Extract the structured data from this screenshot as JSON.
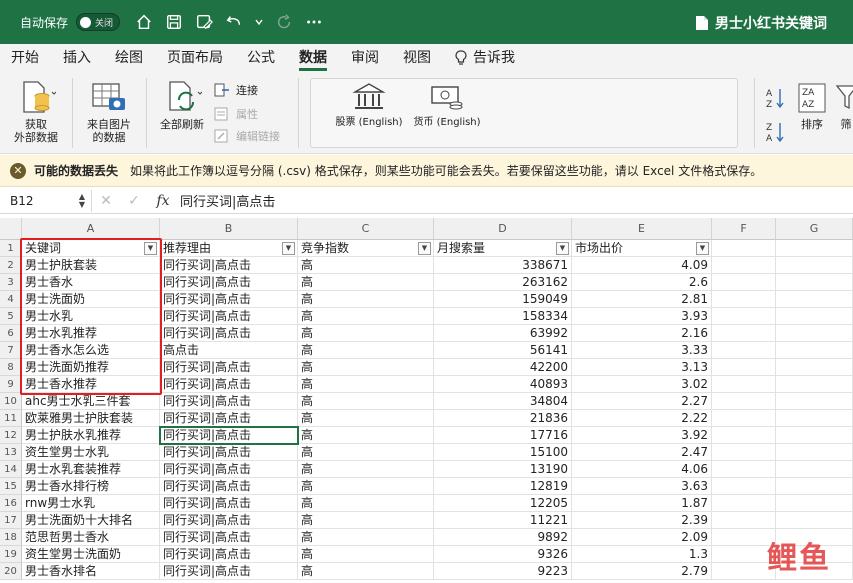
{
  "titlebar": {
    "autosave_label": "自动保存",
    "toggle_label": "关闭",
    "doc_title": "男士小红书关键词"
  },
  "menu": {
    "tabs": [
      {
        "label": "开始"
      },
      {
        "label": "插入"
      },
      {
        "label": "绘图"
      },
      {
        "label": "页面布局"
      },
      {
        "label": "公式"
      },
      {
        "label": "数据"
      },
      {
        "label": "审阅"
      },
      {
        "label": "视图"
      }
    ],
    "tell_me": "告诉我"
  },
  "ribbon": {
    "get_data_line1": "获取",
    "get_data_line2": "外部数据",
    "from_picture_line1": "来自图片",
    "from_picture_line2": "的数据",
    "refresh_all": "全部刷新",
    "connections": "连接",
    "properties": "属性",
    "edit_links": "编辑链接",
    "stocks": "股票 (English)",
    "currencies": "货币 (English)",
    "sort": "排序",
    "filter": "筛"
  },
  "warning": {
    "title": "可能的数据丢失",
    "message": "如果将此工作簿以逗号分隔 (.csv) 格式保存，则某些功能可能会丢失。若要保留这些功能，请以 Excel 文件格式保存。"
  },
  "formula_bar": {
    "name_box": "B12",
    "fx": "fx",
    "formula": "同行买词|高点击"
  },
  "columns": [
    "A",
    "B",
    "C",
    "D",
    "E",
    "F",
    "G"
  ],
  "table": {
    "headers": [
      "关键词",
      "推荐理由",
      "竞争指数",
      "月搜索量",
      "市场出价"
    ],
    "rows": [
      [
        "男士护肤套装",
        "同行买词|高点击",
        "高",
        "338671",
        "4.09"
      ],
      [
        "男士香水",
        "同行买词|高点击",
        "高",
        "263162",
        "2.6"
      ],
      [
        "男士洗面奶",
        "同行买词|高点击",
        "高",
        "159049",
        "2.81"
      ],
      [
        "男士水乳",
        "同行买词|高点击",
        "高",
        "158334",
        "3.93"
      ],
      [
        "男士水乳推荐",
        "同行买词|高点击",
        "高",
        "63992",
        "2.16"
      ],
      [
        "男士香水怎么选",
        "高点击",
        "高",
        "56141",
        "3.33"
      ],
      [
        "男士洗面奶推荐",
        "同行买词|高点击",
        "高",
        "42200",
        "3.13"
      ],
      [
        "男士香水推荐",
        "同行买词|高点击",
        "高",
        "40893",
        "3.02"
      ],
      [
        "ahc男士水乳三件套",
        "同行买词|高点击",
        "高",
        "34804",
        "2.27"
      ],
      [
        "欧莱雅男士护肤套装",
        "同行买词|高点击",
        "高",
        "21836",
        "2.22"
      ],
      [
        "男士护肤水乳推荐",
        "同行买词|高点击",
        "高",
        "17716",
        "3.92"
      ],
      [
        "资生堂男士水乳",
        "同行买词|高点击",
        "高",
        "15100",
        "2.47"
      ],
      [
        "男士水乳套装推荐",
        "同行买词|高点击",
        "高",
        "13190",
        "4.06"
      ],
      [
        "男士香水排行榜",
        "同行买词|高点击",
        "高",
        "12819",
        "3.63"
      ],
      [
        "rnw男士水乳",
        "同行买词|高点击",
        "高",
        "12205",
        "1.87"
      ],
      [
        "男士洗面奶十大排名",
        "同行买词|高点击",
        "高",
        "11221",
        "2.39"
      ],
      [
        "范思哲男士香水",
        "同行买词|高点击",
        "高",
        "9892",
        "2.09"
      ],
      [
        "资生堂男士洗面奶",
        "同行买词|高点击",
        "高",
        "9326",
        "1.3"
      ],
      [
        "男士香水排名",
        "同行买词|高点击",
        "高",
        "9223",
        "2.79"
      ]
    ]
  },
  "watermark": "鲤鱼",
  "colors": {
    "brand": "#1f7244",
    "highlight": "#e02020",
    "warning_bg": "#fdf6dd"
  }
}
